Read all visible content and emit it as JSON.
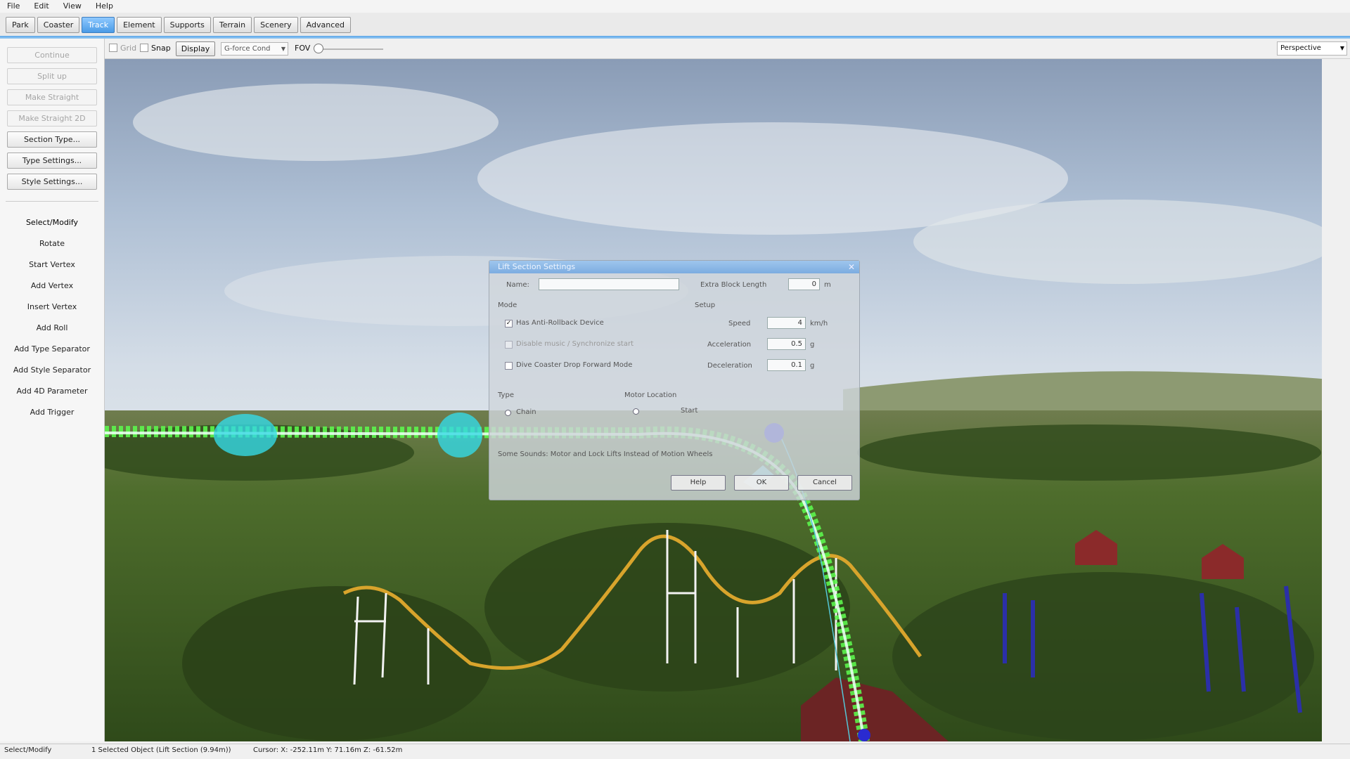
{
  "menu": [
    "File",
    "Edit",
    "View",
    "Help"
  ],
  "tabs": [
    "Park",
    "Coaster",
    "Track",
    "Element",
    "Supports",
    "Terrain",
    "Scenery",
    "Advanced"
  ],
  "active_tab_index": 2,
  "left_panel": {
    "buttons": [
      {
        "label": "Continue",
        "enabled": false
      },
      {
        "label": "Split up",
        "enabled": false
      },
      {
        "label": "Make Straight",
        "enabled": false
      },
      {
        "label": "Make Straight 2D",
        "enabled": false
      },
      {
        "label": "Section Type...",
        "enabled": true
      },
      {
        "label": "Type Settings...",
        "enabled": true
      },
      {
        "label": "Style Settings...",
        "enabled": true
      }
    ],
    "tools": [
      "Select/Modify",
      "Rotate",
      "Start Vertex",
      "Add Vertex",
      "Insert Vertex",
      "Add Roll",
      "Add Type Separator",
      "Add Style Separator",
      "Add 4D Parameter",
      "Add Trigger"
    ]
  },
  "viewport_toolbar": {
    "grid_label": "Grid",
    "snap_label": "Snap",
    "display_label": "Display",
    "gforce_value": "G-force Cond",
    "fov_label": "FOV",
    "fov_value": 0,
    "projection": "Perspective"
  },
  "dialog": {
    "title": "Lift Section Settings",
    "name_label": "Name:",
    "name_value": "",
    "block_label": "Extra Block Length",
    "block_value": "0",
    "block_unit": "m",
    "mode_label": "Mode",
    "setup_label": "Setup",
    "anti_rollback_label": "Has Anti-Rollback Device",
    "anti_rollback_checked": true,
    "launch_label": "Disable music / Synchronize start",
    "dive_label": "Dive Coaster Drop Forward Mode",
    "dive_checked": false,
    "speed_label": "Speed",
    "speed_value": "4",
    "speed_unit": "km/h",
    "accel_label": "Acceleration",
    "accel_value": "0.5",
    "accel_unit": "g",
    "decel_label": "Deceleration",
    "decel_value": "0.1",
    "decel_unit": "g",
    "type_label": "Type",
    "type_option": "Chain",
    "motor_label": "Motor Location",
    "motor_option": "Start",
    "note": "Some Sounds: Motor and Lock Lifts Instead of Motion Wheels",
    "help_label": "Help",
    "ok_label": "OK",
    "cancel_label": "Cancel"
  },
  "status": {
    "mode": "Select/Modify",
    "selection": "1 Selected Object (Lift Section (9.94m))",
    "cursor": "Cursor: X: -252.11m Y: 71.16m Z: -61.52m"
  }
}
